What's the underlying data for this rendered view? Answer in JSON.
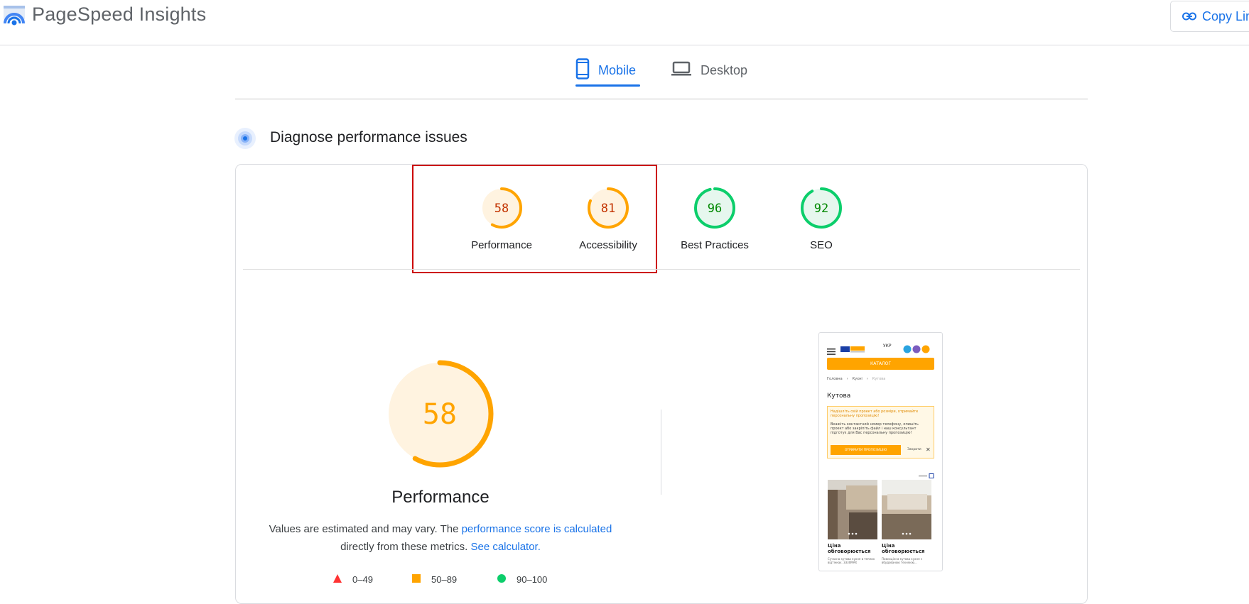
{
  "header": {
    "app_title": "PageSpeed Insights",
    "copy_link_label": "Copy Lin"
  },
  "tabs": [
    {
      "label": "Mobile",
      "active": true,
      "icon": "phone-icon"
    },
    {
      "label": "Desktop",
      "active": false,
      "icon": "laptop-icon"
    }
  ],
  "section": {
    "title": "Diagnose performance issues",
    "icon": "radar-icon"
  },
  "scores": [
    {
      "label": "Performance",
      "value": "58",
      "score": 58,
      "status": "average"
    },
    {
      "label": "Accessibility",
      "value": "81",
      "score": 81,
      "status": "average"
    },
    {
      "label": "Best Practices",
      "value": "96",
      "score": 96,
      "status": "pass"
    },
    {
      "label": "SEO",
      "value": "92",
      "score": 92,
      "status": "pass"
    }
  ],
  "main_gauge": {
    "value": "58",
    "score": 58,
    "title": "Performance"
  },
  "description": {
    "part1": "Values are estimated and may vary. The ",
    "link1": "performance score is calculated",
    "part2": "directly from these metrics. ",
    "link2": "See calculator."
  },
  "legend": [
    {
      "range": "0–49",
      "shape": "triangle",
      "color": "#ff3333"
    },
    {
      "range": "50–89",
      "shape": "square",
      "color": "#ffa400"
    },
    {
      "range": "90–100",
      "shape": "circle",
      "color": "#0cce6b"
    }
  ],
  "colors": {
    "accent": "#1a73e8",
    "average": "#ffa400",
    "average_text": "#c33300",
    "average_bg": "#fff3e0",
    "pass": "#0cce6b",
    "pass_text": "#008800",
    "pass_bg": "#e6f7ee",
    "highlight": "#cc0000"
  },
  "thumbnail": {
    "lang": "УКР",
    "catalog_button": "КАТАЛОГ",
    "breadcrumb": [
      "Головна",
      "Кухні",
      "Кутова"
    ],
    "heading": "Кутова",
    "promo_title": "Надішліть свій проект або розміри, отримайте персональну пропозицію!",
    "promo_text": "Вкажіть контактний номер телефону, опишіть проект або закріпіть файл і наш консультант підготує для Вас персональну пропозицію!",
    "promo_button": "ОТРИМАТИ ПРОПОЗИЦІЮ",
    "close_label": "Закрити",
    "items": [
      {
        "title": "Ціна обговорюється",
        "desc": "Сучасна кутова кухня в теплих відтінках. 3330МАХ"
      },
      {
        "title": "Ціна обговорюється",
        "desc": "Повноцінна кутова кухня з вбудованою технікою..."
      }
    ]
  }
}
